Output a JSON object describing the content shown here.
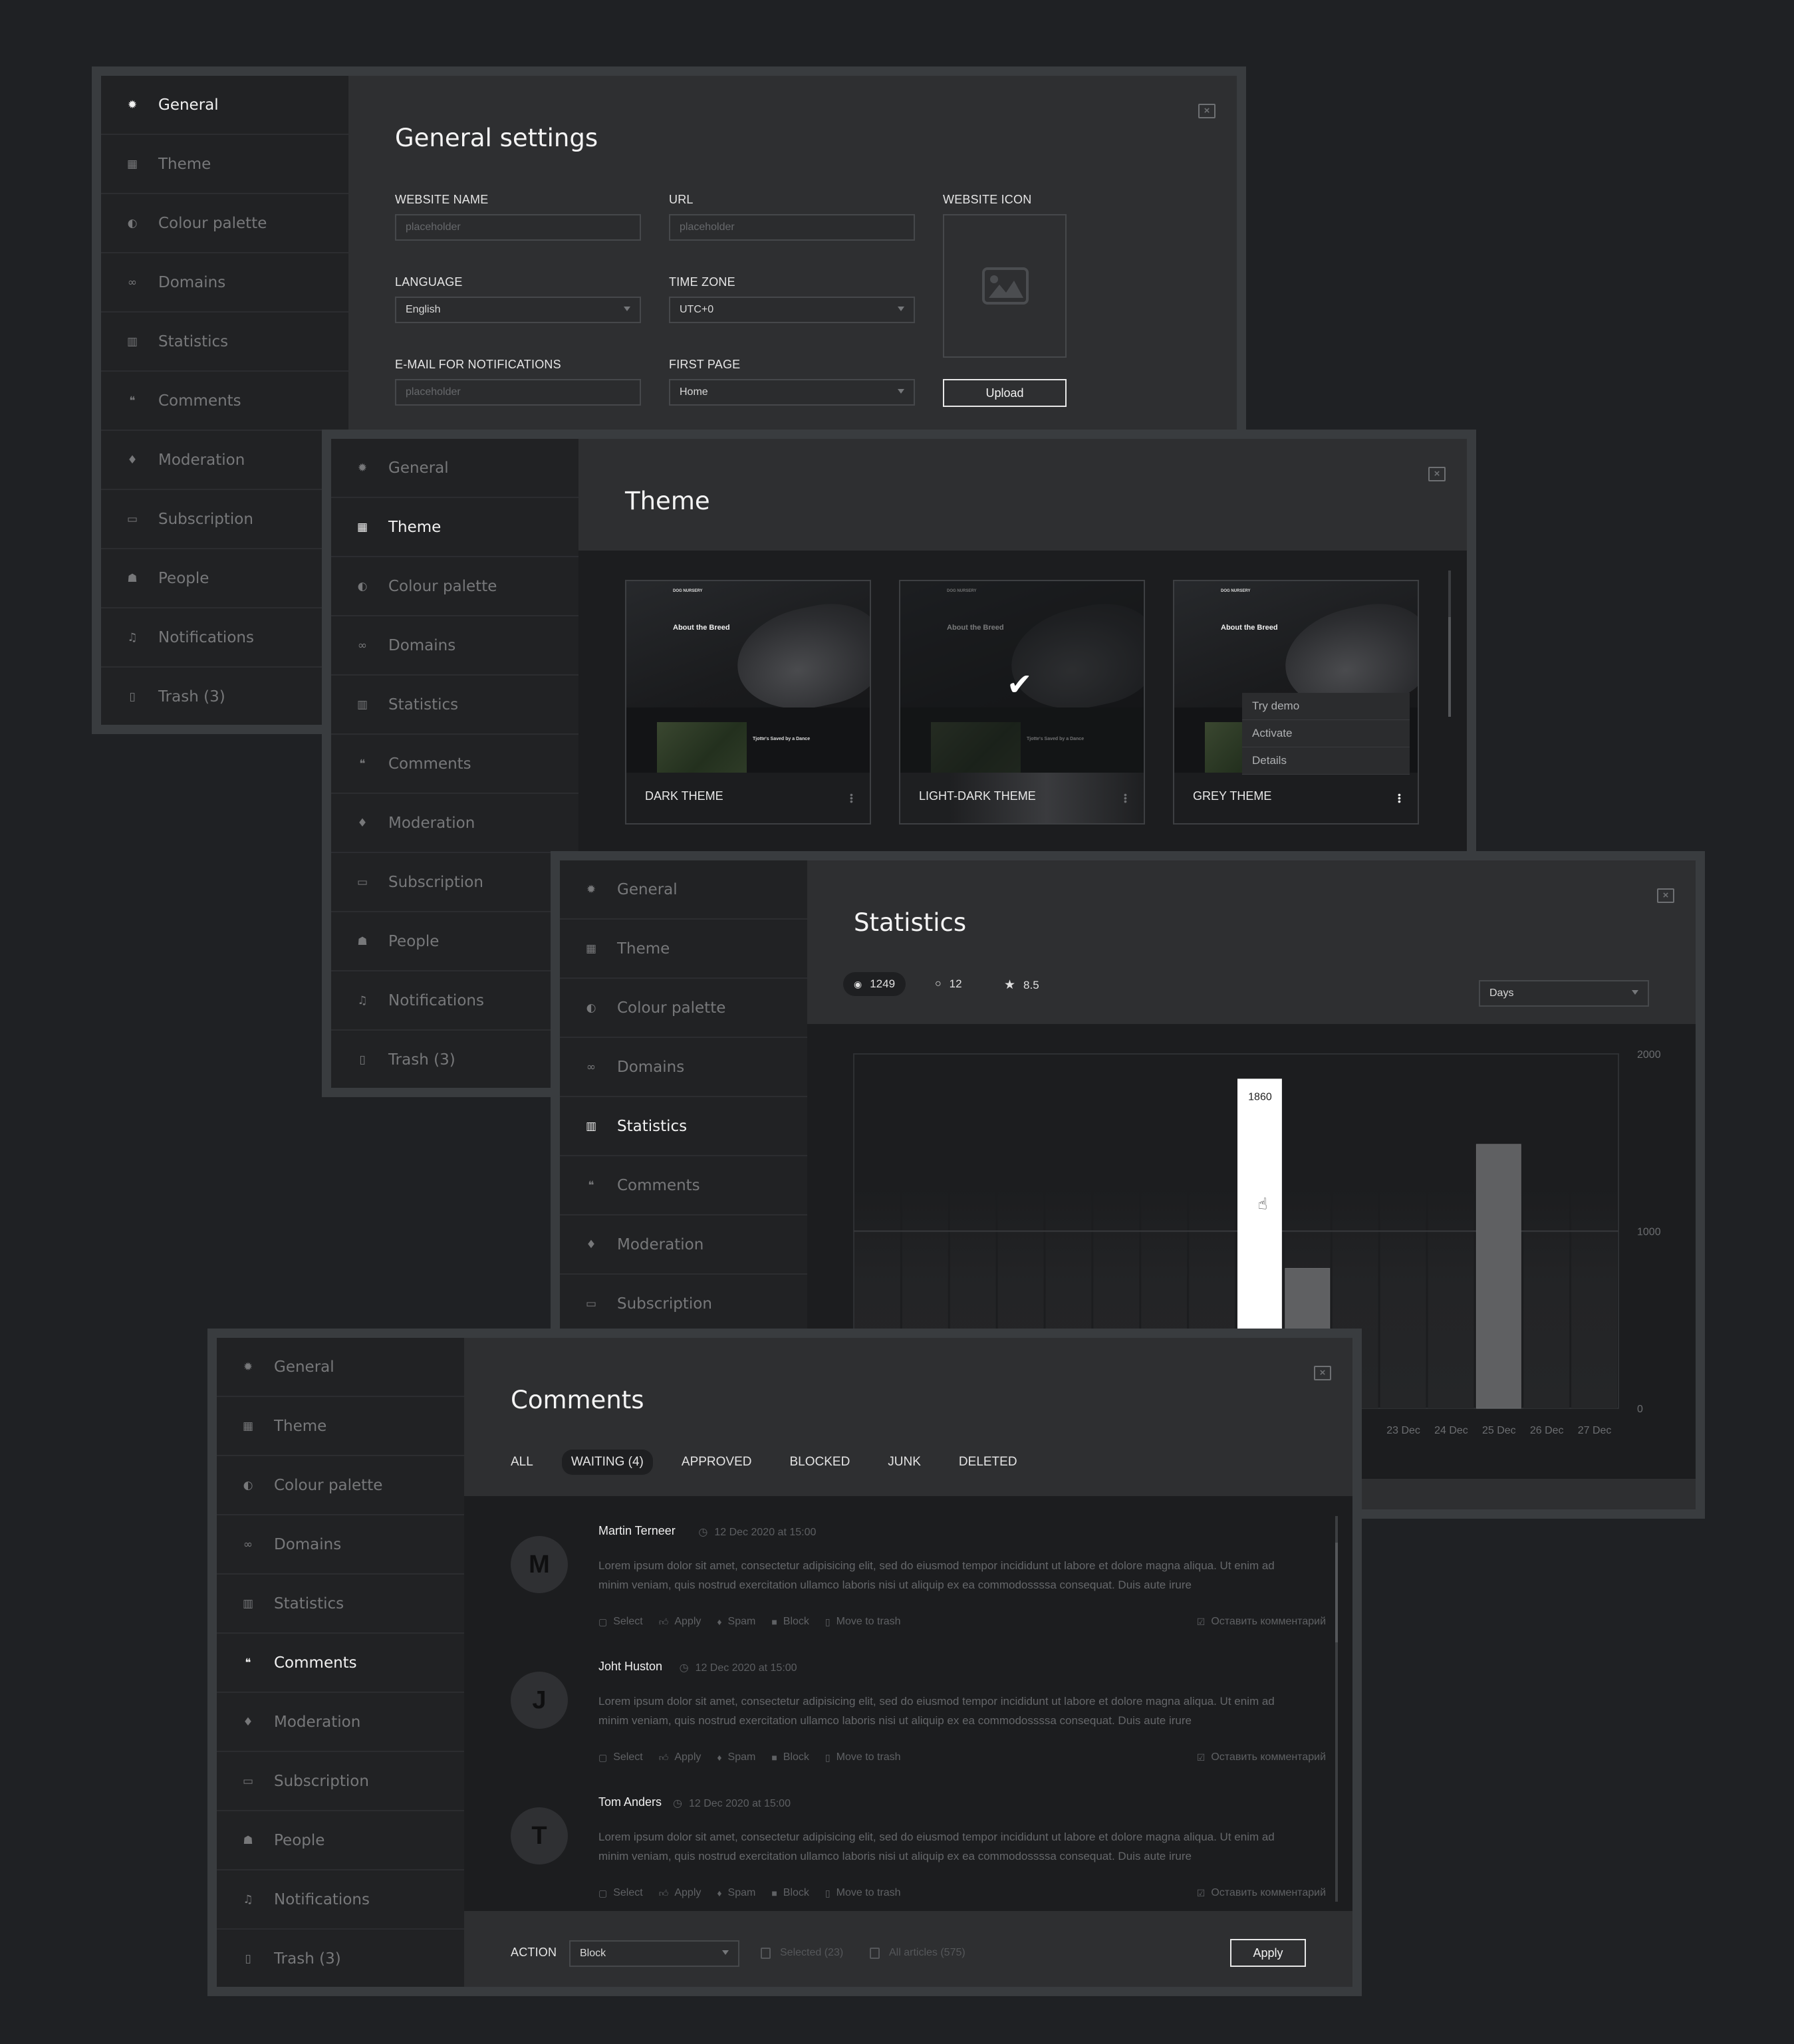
{
  "sidebar": {
    "items": [
      {
        "label": "General",
        "icon": "gear-icon"
      },
      {
        "label": "Theme",
        "icon": "grid-icon"
      },
      {
        "label": "Colour palette",
        "icon": "contrast-icon"
      },
      {
        "label": "Domains",
        "icon": "link-icon"
      },
      {
        "label": "Statistics",
        "icon": "bar-chart-icon"
      },
      {
        "label": "Comments",
        "icon": "chat-bubbles-icon"
      },
      {
        "label": "Moderation",
        "icon": "flame-icon"
      },
      {
        "label": "Subscription",
        "icon": "credit-card-icon"
      },
      {
        "label": "People",
        "icon": "people-icon"
      },
      {
        "label": "Notifications",
        "icon": "bell-icon"
      },
      {
        "label": "Trash (3)",
        "icon": "trash-icon"
      }
    ]
  },
  "general": {
    "title": "General settings",
    "website_name": {
      "label": "WEBSITE NAME",
      "placeholder": "placeholder"
    },
    "url": {
      "label": "URL",
      "placeholder": "placeholder"
    },
    "website_icon": {
      "label": "WEBSITE ICON",
      "upload_label": "Upload"
    },
    "language": {
      "label": "LANGUAGE",
      "value": "English"
    },
    "time_zone": {
      "label": "TIME ZONE",
      "value": "UTC+0"
    },
    "email": {
      "label": "E-MAIL FOR NOTIFICATIONS",
      "placeholder": "placeholder"
    },
    "first_page": {
      "label": "FIRST PAGE",
      "value": "Home"
    }
  },
  "theme": {
    "title": "Theme",
    "preview": {
      "brand": "DOG NURSERY",
      "heading": "About the Breed",
      "subheading": "Tjotte's Saved by a Dance"
    },
    "cards": [
      {
        "name": "DARK THEME",
        "selected": false
      },
      {
        "name": "LIGHT-DARK THEME",
        "selected": true
      },
      {
        "name": "GREY THEME",
        "selected": false
      }
    ],
    "menu": [
      "Try demo",
      "Activate",
      "Details"
    ]
  },
  "statistics": {
    "title": "Statistics",
    "views": "1249",
    "comments": "12",
    "rating": "8.5",
    "period": "Days",
    "tooltip_value": "1860"
  },
  "chart_data": {
    "type": "bar",
    "title": "Statistics",
    "categories": [
      "",
      "",
      "",
      "",
      "",
      "",
      "",
      "",
      "",
      "",
      "",
      "23 Dec",
      "24 Dec",
      "25 Dec",
      "26 Dec",
      "27 Dec"
    ],
    "values": [
      null,
      null,
      null,
      null,
      null,
      null,
      null,
      null,
      1860,
      790,
      null,
      null,
      null,
      1490,
      null,
      null
    ],
    "highlighted_index": 8,
    "yticks": [
      0,
      1000,
      2000
    ],
    "ylim": [
      0,
      2000
    ],
    "xlabel": "",
    "ylabel": "",
    "y_axis_side": "right",
    "grid": true
  },
  "comments": {
    "title": "Comments",
    "tabs": [
      "ALL",
      "WAITING (4)",
      "APPROVED",
      "BLOCKED",
      "JUNK",
      "DELETED"
    ],
    "active_tab": 1,
    "items": [
      {
        "initial": "M",
        "name": "Martin Terneer",
        "time": "12 Dec 2020  at  15:00",
        "text": "Lorem ipsum dolor sit amet, consectetur adipisicing elit, sed do eiusmod tempor incididunt ut labore et dolore magna aliqua. Ut enim ad minim veniam, quis nostrud exercitation ullamco laboris nisi ut aliquip ex ea commodossssa consequat. Duis aute irure"
      },
      {
        "initial": "J",
        "name": "Joht Huston",
        "time": "12 Dec 2020  at  15:00",
        "text": "Lorem ipsum dolor sit amet, consectetur adipisicing elit, sed do eiusmod tempor incididunt ut labore et dolore magna aliqua. Ut enim ad minim veniam, quis nostrud exercitation ullamco laboris nisi ut aliquip ex ea commodossssa consequat. Duis aute irure"
      },
      {
        "initial": "T",
        "name": "Tom Anders",
        "time": "12 Dec 2020  at  15:00",
        "text": "Lorem ipsum dolor sit amet, consectetur adipisicing elit, sed do eiusmod tempor incididunt ut labore et dolore magna aliqua. Ut enim ad minim veniam, quis nostrud exercitation ullamco laboris nisi ut aliquip ex ea commodossssa consequat. Duis aute irure"
      }
    ],
    "actions": {
      "select": "Select",
      "apply": "Apply",
      "spam": "Spam",
      "block": "Block",
      "trash": "Move to trash",
      "reply": "Оставить комментарий"
    },
    "footer": {
      "action_label": "ACTION",
      "action_value": "Block",
      "selected": "Selected (23)",
      "all": "All articles (575)",
      "apply": "Apply"
    }
  }
}
